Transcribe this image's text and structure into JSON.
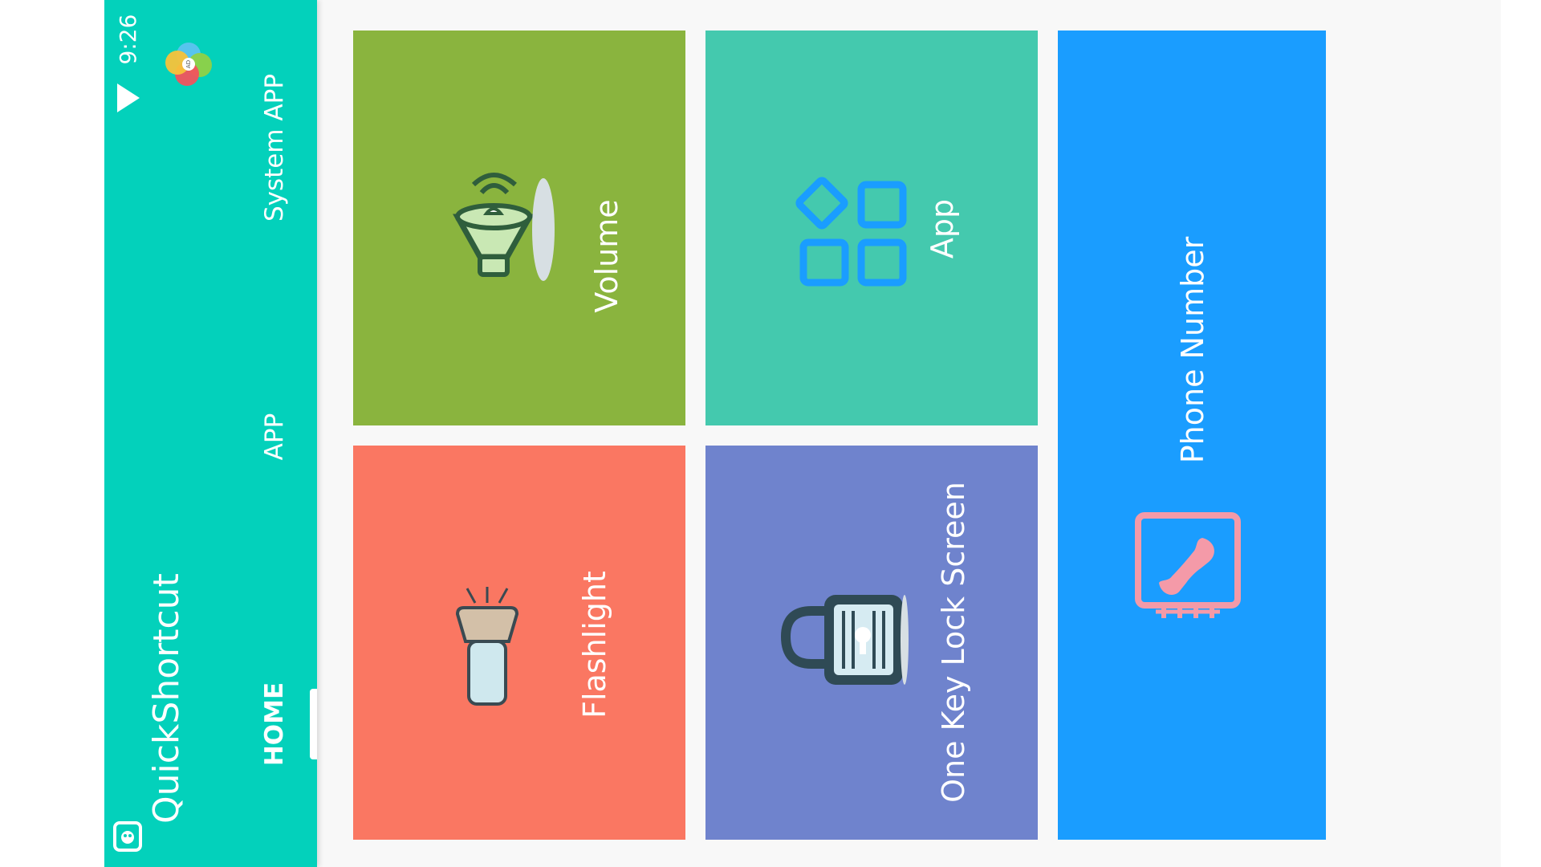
{
  "status_bar": {
    "time": "9:26"
  },
  "app": {
    "title": "QuickShortcut"
  },
  "tabs": [
    {
      "label": "HOME",
      "active": true
    },
    {
      "label": "APP",
      "active": false
    },
    {
      "label": "System APP",
      "active": false
    }
  ],
  "ad_badge": "AD",
  "tiles": [
    {
      "label": "Volume",
      "color": "#8ab43e",
      "icon": "speaker-icon"
    },
    {
      "label": "App",
      "color": "#44c9ae",
      "icon": "app-grid-icon"
    },
    {
      "label": "Phone Number",
      "color": "#1a9dff",
      "icon": "phone-icon"
    },
    {
      "label": "Flashlight",
      "color": "#fa7762",
      "icon": "flashlight-icon"
    },
    {
      "label": "One Key Lock Screen",
      "color": "#6f83cd",
      "icon": "padlock-icon"
    }
  ],
  "colors": {
    "sidebar": "#03d1bb",
    "background": "#f8f8f8"
  }
}
